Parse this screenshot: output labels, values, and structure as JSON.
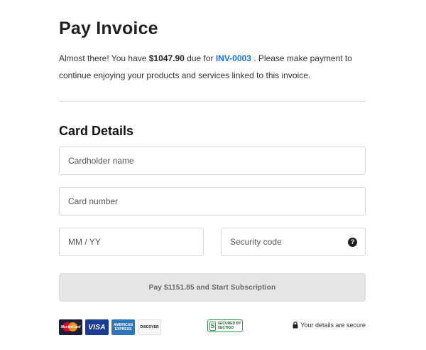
{
  "page_title": "Pay Invoice",
  "intro": {
    "prefix": "Almost there! You have ",
    "amount_due": "$1047.90",
    "middle": " due for ",
    "invoice_id": "INV-0003",
    "suffix": " . Please make payment to continue enjoying your products and services linked to this invoice."
  },
  "card_details": {
    "title": "Card Details",
    "cardholder_placeholder": "Cardholder name",
    "card_number_placeholder": "Card number",
    "expiry_placeholder": "MM / YY",
    "security_code_placeholder": "Security code",
    "help_glyph": "?"
  },
  "pay_button_label": "Pay $1151.85 and Start Subscription",
  "footer": {
    "cards": [
      {
        "icon": "mastercard-icon",
        "label": "MasterCard"
      },
      {
        "icon": "visa-icon",
        "label": "VISA"
      },
      {
        "icon": "amex-icon",
        "label": "AMERICAN EXPRESS"
      },
      {
        "icon": "discover-icon",
        "label": "DISCOVER"
      }
    ],
    "trust_badge": "SECURED BY SECTIGO",
    "secure_text": "Your details are secure"
  },
  "colors": {
    "link": "#1a73e8",
    "button_bg": "#e5e5e5",
    "border": "#d7d7d7",
    "sectigo_green": "#2e9a4b"
  }
}
